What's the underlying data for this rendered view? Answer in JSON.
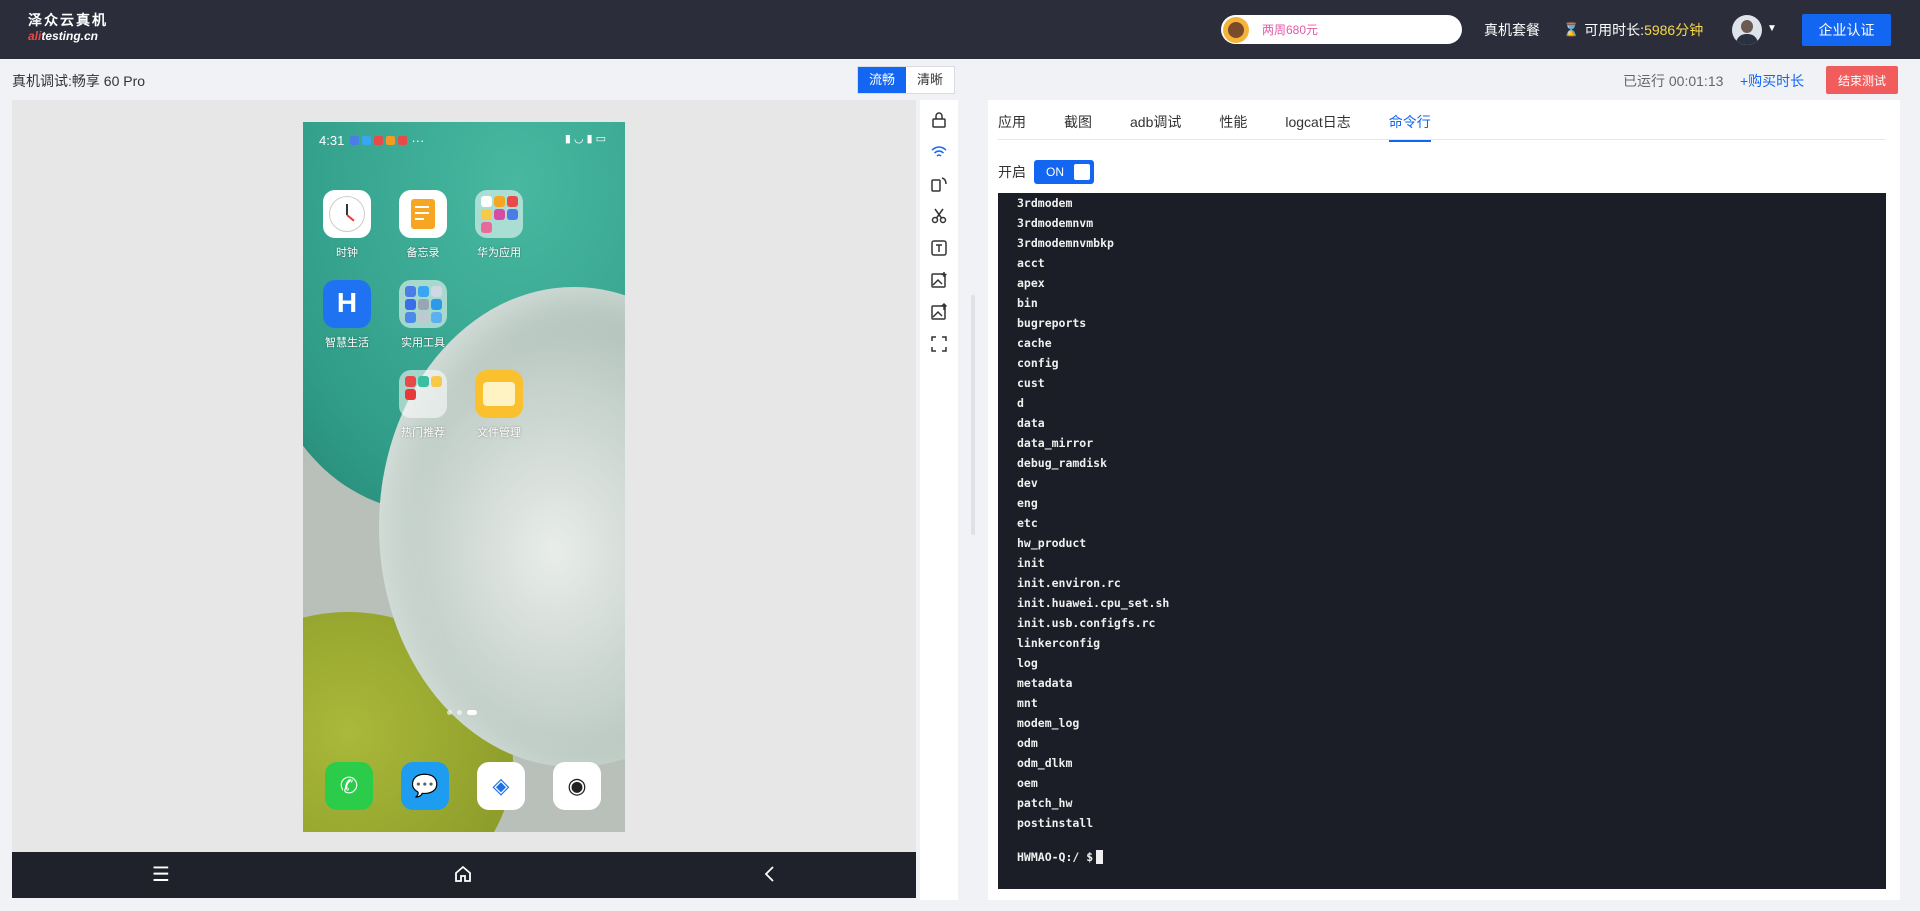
{
  "brand": {
    "name": "泽众云真机",
    "domain_prefix": "ali",
    "domain_suffix": "testing.cn"
  },
  "header": {
    "promo_text": "两周680元",
    "package_label": "真机套餐",
    "time_label": "可用时长:",
    "time_value": "5986分钟",
    "enterprise_button": "企业认证"
  },
  "session": {
    "device_label": "真机调试:畅享 60 Pro",
    "quality_options": [
      "流畅",
      "清晰"
    ],
    "quality_selected": "流畅",
    "running_label": "已运行 00:01:13",
    "buy_time_label": "+购买时长",
    "end_button": "结束测试"
  },
  "phone": {
    "status_time": "4:31",
    "status_more": "···",
    "apps": [
      {
        "label": "时钟",
        "icon": "clock-icon"
      },
      {
        "label": "备忘录",
        "icon": "memo-icon"
      },
      {
        "label": "华为应用",
        "icon": "folder-icon"
      },
      {
        "label": "智慧生活",
        "icon": "smart-life-icon"
      },
      {
        "label": "实用工具",
        "icon": "folder-icon"
      },
      {
        "label": "热门推荐",
        "icon": "folder-icon"
      },
      {
        "label": "文件管理",
        "icon": "files-icon"
      }
    ],
    "dock": [
      "phone-icon",
      "message-icon",
      "browser-icon",
      "camera-icon"
    ]
  },
  "navbar": {
    "icons": [
      "menu-icon",
      "home-icon",
      "back-icon"
    ]
  },
  "tools": [
    "lock-icon",
    "wifi-icon",
    "rotate-icon",
    "scissors-icon",
    "text-icon",
    "image-add-icon",
    "image-upload-icon",
    "fullscreen-icon"
  ],
  "tabs": {
    "items": [
      "应用",
      "截图",
      "adb调试",
      "性能",
      "logcat日志",
      "命令行"
    ],
    "active": "命令行"
  },
  "terminal": {
    "switch_label": "开启",
    "switch_state": "ON",
    "lines": [
      "3rdmodem",
      "3rdmodemnvm",
      "3rdmodemnvmbkp",
      "acct",
      "apex",
      "bin",
      "bugreports",
      "cache",
      "config",
      "cust",
      "d",
      "data",
      "data_mirror",
      "debug_ramdisk",
      "dev",
      "eng",
      "etc",
      "hw_product",
      "init",
      "init.environ.rc",
      "init.huawei.cpu_set.sh",
      "init.usb.configfs.rc",
      "linkerconfig",
      "log",
      "metadata",
      "mnt",
      "modem_log",
      "odm",
      "odm_dlkm",
      "oem",
      "patch_hw",
      "postinstall"
    ],
    "prompt": "HWMAO-Q:/ $"
  },
  "colors": {
    "accent": "#1366f1",
    "danger": "#f15d5d",
    "topbar": "#2b2e3a",
    "terminal_bg": "#1b1e27"
  }
}
